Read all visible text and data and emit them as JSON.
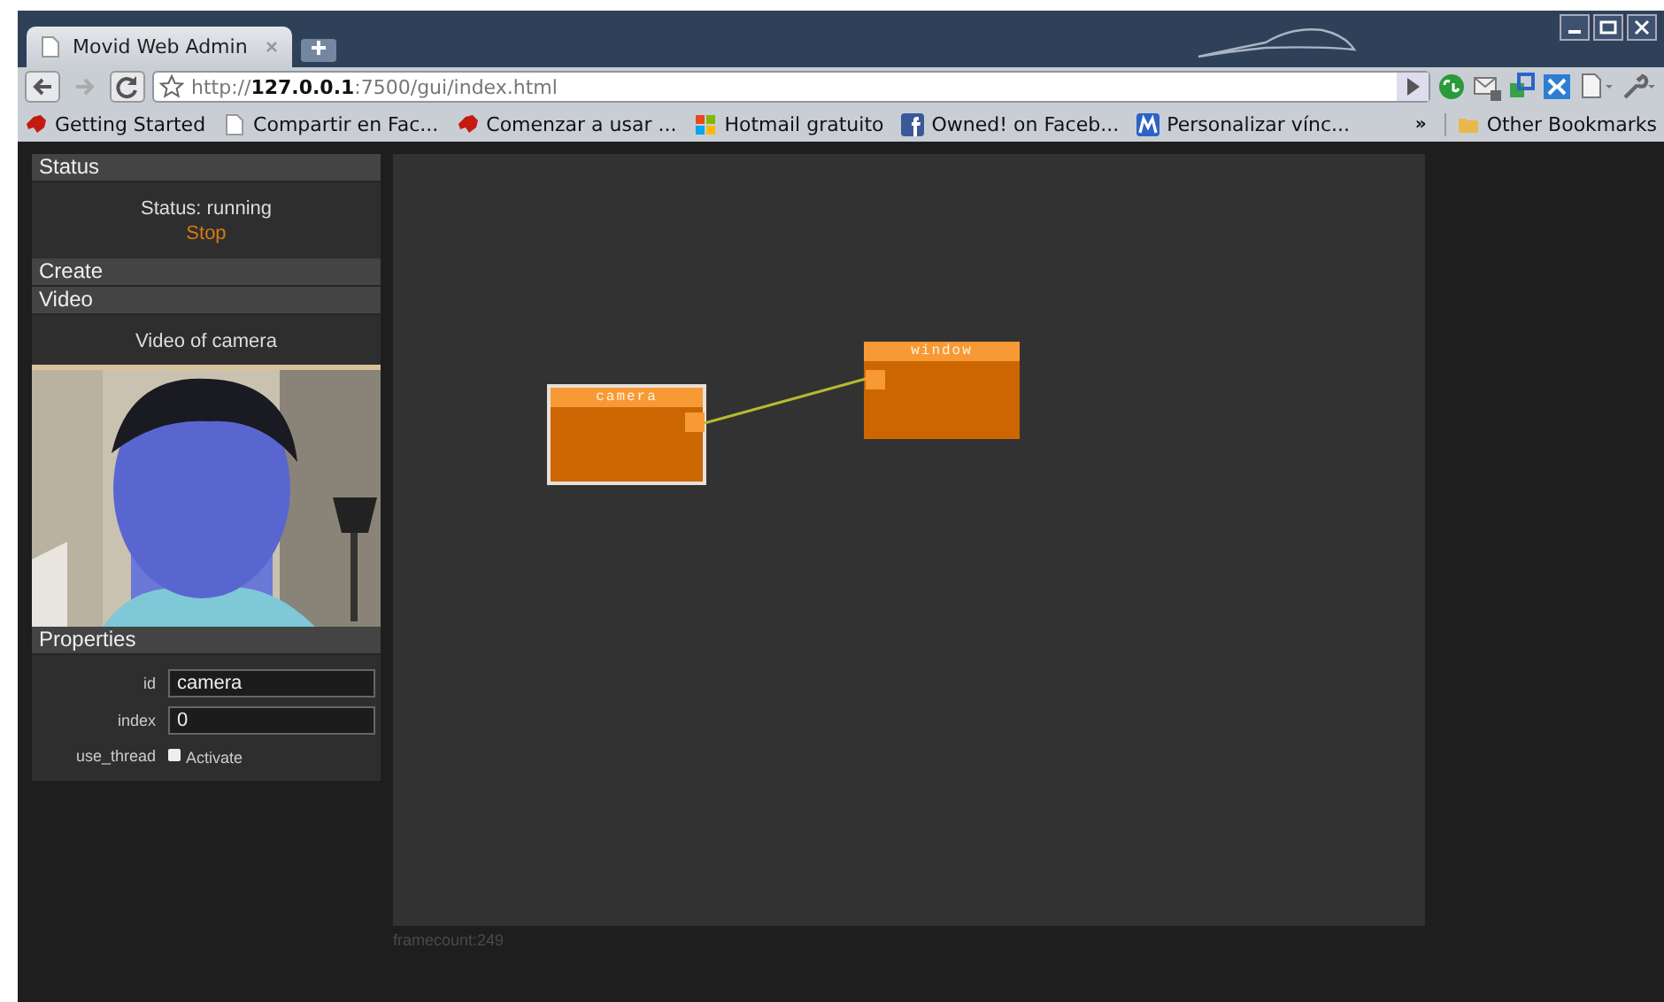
{
  "browser": {
    "tabs": [
      {
        "title": "Movid Web Admin",
        "selected": true
      }
    ],
    "address": "http://**127.0.0.1**:7500/gui/index.html",
    "bookmarks": [
      {
        "kind": "beast",
        "label": "Getting Started"
      },
      {
        "kind": "page",
        "label": "Compartir en Fac..."
      },
      {
        "kind": "beast",
        "label": "Comenzar a usar ..."
      },
      {
        "kind": "windows",
        "label": "Hotmail gratuito"
      },
      {
        "kind": "facebook",
        "label": "Owned! on Faceb..."
      },
      {
        "kind": "m",
        "label": "Personalizar vínc..."
      }
    ],
    "overflow": "»",
    "other_bookmarks": "Other Bookmarks"
  },
  "sidebar": {
    "status": {
      "heading": "Status",
      "text": "Status: running",
      "action": "Stop"
    },
    "create": {
      "heading": "Create"
    },
    "video": {
      "heading": "Video",
      "caption": "Video of camera",
      "kind": "picture"
    },
    "properties": {
      "heading": "Properties",
      "fields": [
        {
          "kind": "text",
          "label": "id",
          "value": "camera"
        },
        {
          "kind": "text",
          "label": "index",
          "value": "0"
        },
        {
          "kind": "checkbox",
          "label": "use_thread",
          "option": "Activate",
          "checked": false
        }
      ]
    }
  },
  "canvas": {
    "nodes": [
      {
        "title": "camera",
        "selected": true
      },
      {
        "title": "window",
        "selected": false
      }
    ],
    "connected": true
  },
  "framecount": "framecount:249"
}
